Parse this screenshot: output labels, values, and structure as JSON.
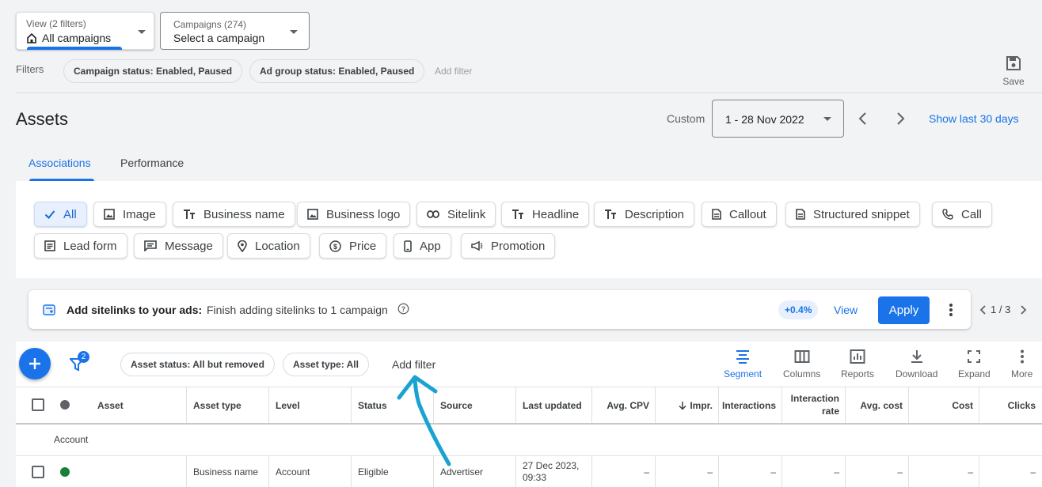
{
  "view": {
    "label": "View (2 filters)",
    "value": "All campaigns"
  },
  "campaigns": {
    "label": "Campaigns (274)",
    "value": "Select a campaign"
  },
  "filters": {
    "label": "Filters",
    "chips": [
      "Campaign status: Enabled, Paused",
      "Ad group status: Enabled, Paused"
    ],
    "add": "Add filter"
  },
  "save_label": "Save",
  "page_title": "Assets",
  "date": {
    "custom": "Custom",
    "range": "1 - 28 Nov 2022",
    "show_last": "Show last 30 days"
  },
  "tabs": [
    {
      "label": "Associations"
    },
    {
      "label": "Performance"
    }
  ],
  "type_chips": [
    {
      "label": "All",
      "icon": "check-icon"
    },
    {
      "label": "Image",
      "icon": "image-icon"
    },
    {
      "label": "Business name",
      "icon": "text-icon"
    },
    {
      "label": "Business logo",
      "icon": "image-icon"
    },
    {
      "label": "Sitelink",
      "icon": "link-icon"
    },
    {
      "label": "Headline",
      "icon": "text-icon"
    },
    {
      "label": "Description",
      "icon": "text-icon"
    },
    {
      "label": "Callout",
      "icon": "document-icon"
    },
    {
      "label": "Structured snippet",
      "icon": "document-icon"
    },
    {
      "label": "Call",
      "icon": "phone-icon"
    },
    {
      "label": "Lead form",
      "icon": "form-icon"
    },
    {
      "label": "Message",
      "icon": "message-icon"
    },
    {
      "label": "Location",
      "icon": "location-icon"
    },
    {
      "label": "Price",
      "icon": "price-icon"
    },
    {
      "label": "App",
      "icon": "phone-app-icon"
    },
    {
      "label": "Promotion",
      "icon": "megaphone-icon"
    }
  ],
  "recommendation": {
    "title": "Add sitelinks to your ads:",
    "text": "Finish adding sitelinks to 1 campaign",
    "badge": "+0.4%",
    "view": "View",
    "apply": "Apply",
    "pager": "1 / 3"
  },
  "toolbar": {
    "filter_count": "2",
    "chips": [
      "Asset status: All but removed",
      "Asset type: All"
    ],
    "add_filter": "Add filter",
    "buttons": [
      "Segment",
      "Columns",
      "Reports",
      "Download",
      "Expand",
      "More"
    ]
  },
  "table": {
    "headers": [
      "Asset",
      "Asset type",
      "Level",
      "Status",
      "Source",
      "Last updated",
      "Avg. CPV",
      "Impr.",
      "Interactions",
      "Interaction rate",
      "Avg. cost",
      "Cost",
      "Clicks"
    ],
    "group_label": "Account",
    "row": [
      "",
      "Business name",
      "Account",
      "Eligible",
      "Advertiser",
      "27 Dec 2023, 09:33",
      "–",
      "–",
      "–",
      "–",
      "–",
      "–",
      "–"
    ]
  },
  "colors": {
    "accent": "#1a73e8",
    "annotation": "#1aa3d1",
    "status_enabled": "#188038"
  }
}
